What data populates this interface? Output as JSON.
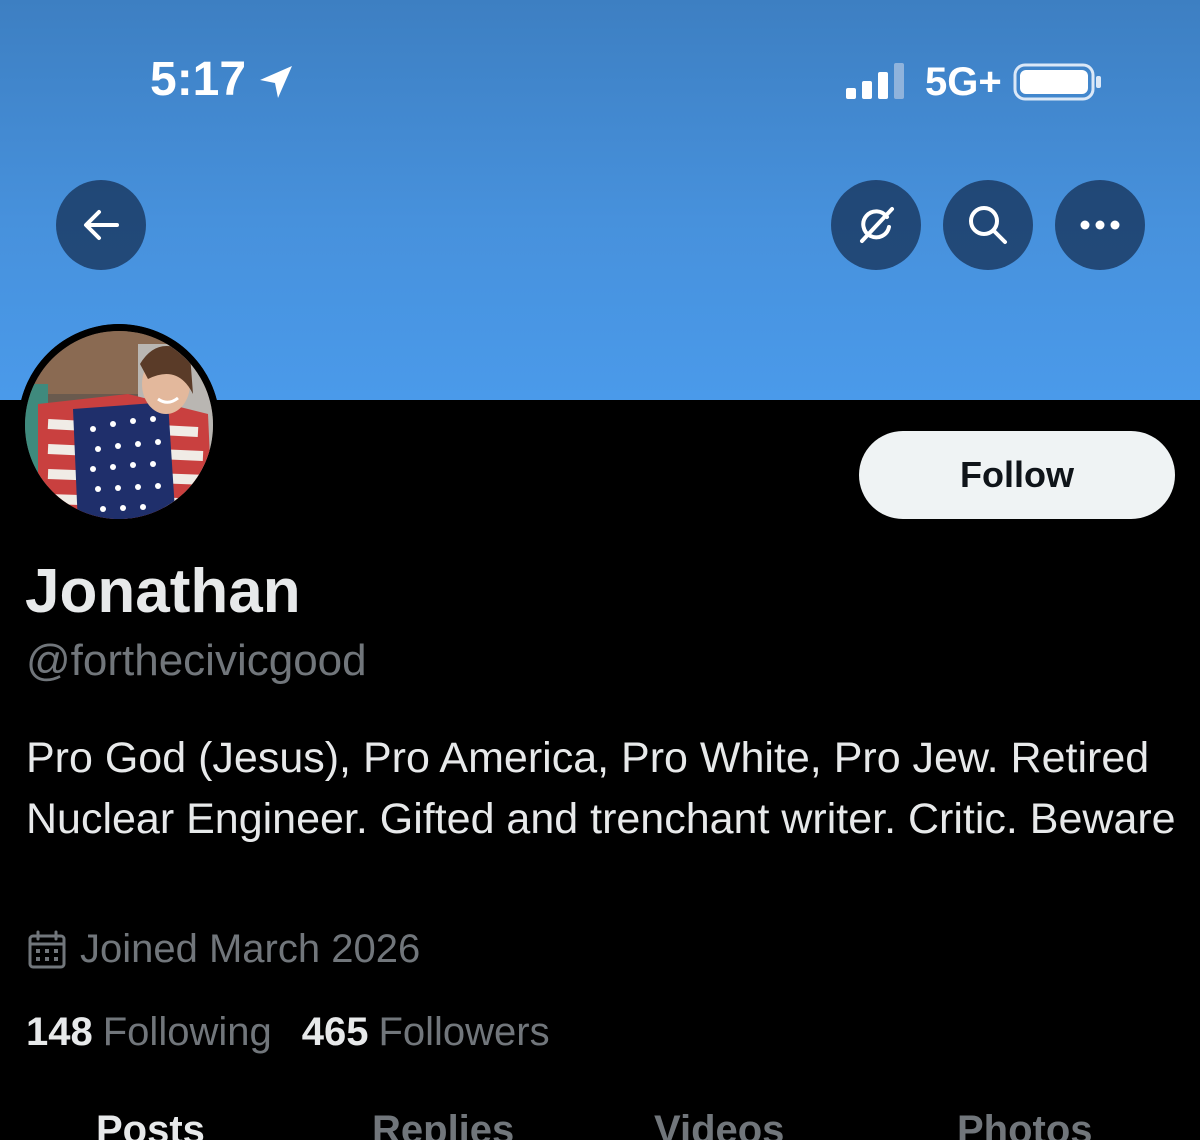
{
  "status_bar": {
    "time": "5:17",
    "network": "5G+"
  },
  "header": {
    "back_icon": "arrow-left-icon",
    "grok_icon": "grok-icon",
    "search_icon": "search-icon",
    "more_icon": "more-horizontal-icon",
    "banner_color": "#4791dc"
  },
  "profile": {
    "name": "Jonathan",
    "handle": "@forthecivicgood",
    "bio": "Pro God (Jesus), Pro America, Pro White, Pro Jew. Retired Nuclear Engineer. Gifted and trenchant writer. Critic. Beware",
    "joined": "Joined March 2026",
    "follow_label": "Follow"
  },
  "stats": {
    "following_count": "148",
    "following_label": "Following",
    "followers_count": "465",
    "followers_label": "Followers"
  },
  "tabs": [
    {
      "label": "Posts",
      "active": true
    },
    {
      "label": "Replies",
      "active": false
    },
    {
      "label": "Videos",
      "active": false
    },
    {
      "label": "Photos",
      "active": false
    }
  ],
  "colors": {
    "background": "#000000",
    "primary_text": "#e7e9ea",
    "secondary_text": "#71767b",
    "button_bg": "#eff3f4"
  }
}
